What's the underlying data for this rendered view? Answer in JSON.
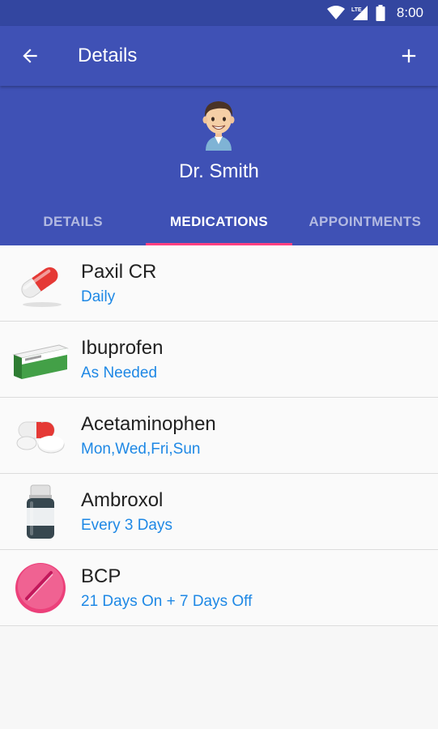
{
  "status_bar": {
    "time": "8:00",
    "network": "LTE"
  },
  "app_bar": {
    "title": "Details"
  },
  "profile": {
    "name": "Dr. Smith"
  },
  "tabs": [
    {
      "label": "DETAILS",
      "active": false
    },
    {
      "label": "MEDICATIONS",
      "active": true
    },
    {
      "label": "APPOINTMENTS",
      "active": false
    }
  ],
  "medications": [
    {
      "name": "Paxil CR",
      "schedule": "Daily",
      "icon": "capsule-icon"
    },
    {
      "name": "Ibuprofen",
      "schedule": "As Needed",
      "icon": "medicine-box-icon"
    },
    {
      "name": "Acetaminophen",
      "schedule": "Mon,Wed,Fri,Sun",
      "icon": "pills-icon"
    },
    {
      "name": "Ambroxol",
      "schedule": "Every 3 Days",
      "icon": "pill-bottle-icon"
    },
    {
      "name": "BCP",
      "schedule": "21 Days On + 7 Days Off",
      "icon": "round-pill-icon"
    }
  ],
  "colors": {
    "primary": "#3f51b5",
    "primary_dark": "#3346a0",
    "accent": "#ff4081",
    "schedule_text": "#1e88e5"
  }
}
